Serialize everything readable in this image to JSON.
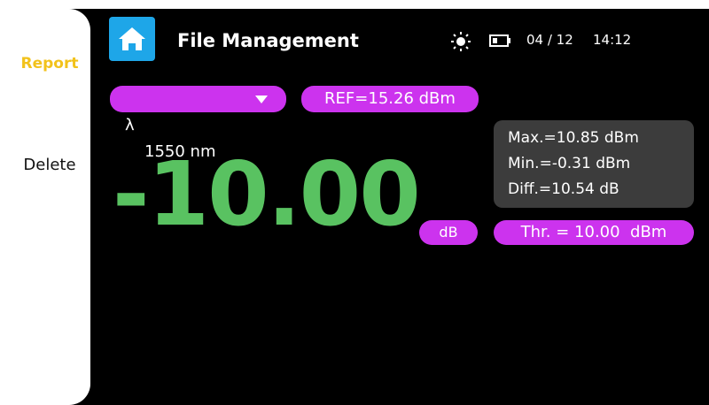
{
  "sidebar": {
    "items": [
      {
        "label": "Report"
      },
      {
        "label": "Delete"
      }
    ]
  },
  "header": {
    "title": "File Management",
    "date": "04 / 12",
    "time": "14:12",
    "icons": [
      "home-icon",
      "brightness-icon",
      "battery-icon"
    ],
    "accent_color": "#1ea6e8"
  },
  "controls": {
    "wavelength_symbol": "λ",
    "wavelength": "1550 nm",
    "ref": "REF=15.26 dBm",
    "threshold": "Thr. = 10.00  dBm"
  },
  "measurement": {
    "value": "-10.00",
    "unit": "dB",
    "value_color": "#59c261"
  },
  "stats": {
    "max": "Max.=10.85 dBm",
    "min": "Min.=-0.31 dBm",
    "diff": "Diff.=10.54 dB"
  },
  "colors": {
    "pill": "#cc33ee",
    "report_active": "#f2c21b"
  }
}
